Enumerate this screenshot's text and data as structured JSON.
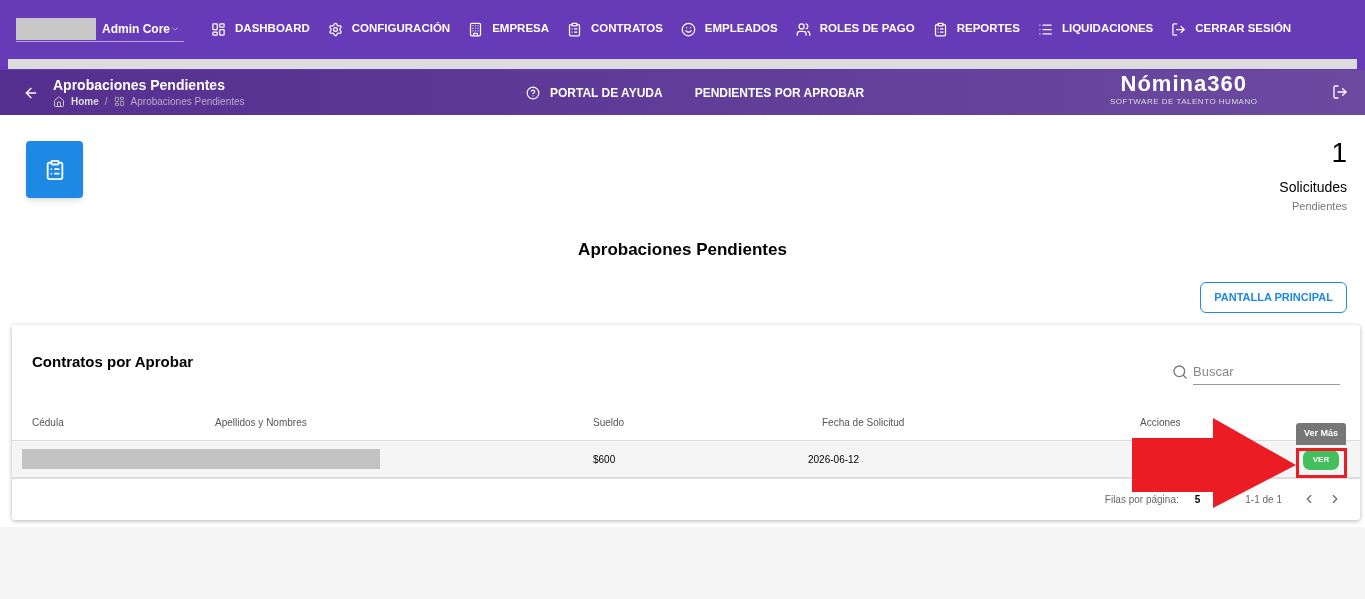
{
  "nav": {
    "brand": "Admin Core",
    "items": [
      {
        "label": "DASHBOARD"
      },
      {
        "label": "CONFIGURACIÓN"
      },
      {
        "label": "EMPRESA"
      },
      {
        "label": "CONTRATOS"
      },
      {
        "label": "EMPLEADOS"
      },
      {
        "label": "ROLES DE PAGO"
      },
      {
        "label": "REPORTES"
      },
      {
        "label": "LIQUIDACIONES"
      },
      {
        "label": "CERRAR SESIÓN"
      }
    ]
  },
  "subheader": {
    "title": "Aprobaciones Pendientes",
    "breadcrumb": [
      "Home",
      "/",
      "Aprobaciones Pendientes"
    ],
    "links": [
      "PORTAL DE AYUDA",
      "PENDIENTES POR APROBAR"
    ],
    "logo": "Nómina360",
    "tagline": "SOFTWARE DE TALENTO HUMANO"
  },
  "stats": {
    "count": "1",
    "label": "Solicitudes",
    "sublabel": "Pendientes"
  },
  "heading": "Aprobaciones Pendientes",
  "main_button": "PANTALLA PRINCIPAL",
  "table": {
    "title": "Contratos por Aprobar",
    "search": {
      "placeholder": "Buscar"
    },
    "columns": [
      "Cédula",
      "Apellidos y Nombres",
      "Sueldo",
      "Fecha de Solicitud",
      "Acciones"
    ],
    "rows": [
      {
        "redacted": true,
        "sueldo": "$600",
        "fecha": "2026-06-12",
        "action": "VER",
        "tooltip": "Ver Más"
      }
    ],
    "pagination": {
      "rows_label": "Filas por página:",
      "rows_value": "5",
      "range": "1-1 de 1"
    }
  },
  "annotations": [
    {
      "kind": "arrow"
    },
    {
      "kind": "highlight-box"
    }
  ]
}
